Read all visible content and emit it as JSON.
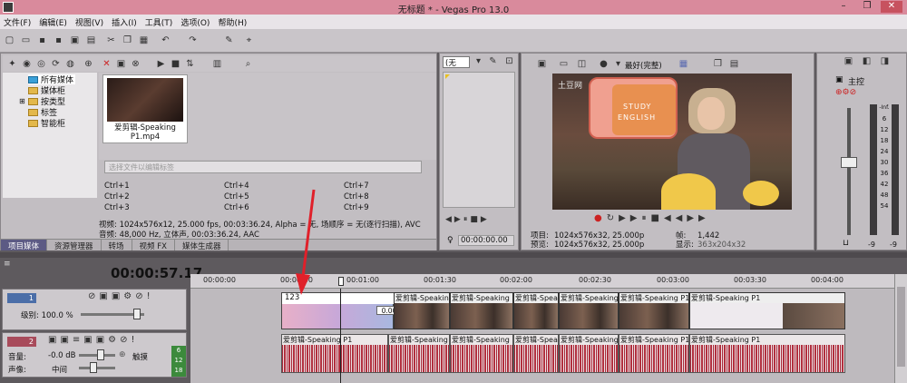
{
  "window": {
    "title": "无标题 * - Vegas Pro 13.0",
    "minimize": "–",
    "maximize": "❐",
    "close": "✕"
  },
  "menu": [
    "文件(F)",
    "编辑(E)",
    "视图(V)",
    "插入(I)",
    "工具(T)",
    "选项(O)",
    "帮助(H)"
  ],
  "media": {
    "tree": [
      "所有媒体",
      "媒体柜",
      "按类型",
      "标签",
      "智能柜"
    ],
    "thumb_label": "爱剪辑-Speaking P1.mp4",
    "tag_placeholder": "选择文件以编辑标签",
    "shortcuts": [
      "Ctrl+1",
      "Ctrl+2",
      "Ctrl+3",
      "Ctrl+4",
      "Ctrl+5",
      "Ctrl+6",
      "Ctrl+7",
      "Ctrl+8",
      "Ctrl+9"
    ],
    "info1": "视频: 1024x576x12, 25.000 fps, 00:03:36.24, Alpha = 无, 场顺序 = 无(逐行扫描), AVC",
    "info2": "音频: 48,000 Hz, 立体声, 00:03:36.24, AAC",
    "tabs": [
      "项目媒体",
      "资源管理器",
      "转场",
      "视频 FX",
      "媒体生成器"
    ]
  },
  "trimmer": {
    "select": "(无",
    "time": "00:00:00.00"
  },
  "preview": {
    "quality": "最好(完整)",
    "project_label": "项目:",
    "project": "1024x576x32, 25.000p",
    "preview_label": "预览:",
    "preview": "1024x576x32, 25.000p",
    "frame_label": "帧:",
    "frame": "1,442",
    "display_label": "显示:",
    "display": "363x204x32",
    "logo": "土豆网",
    "study_line1": "STUDY",
    "study_line2": "ENGLISH"
  },
  "mixer": {
    "label": "主控",
    "scale": [
      "-Inf.",
      "6",
      "12",
      "18",
      "24",
      "30",
      "36",
      "42",
      "48",
      "54"
    ],
    "bottom": [
      "-9",
      "-9"
    ]
  },
  "timeline": {
    "time": "00:00:57.17",
    "ruler": [
      "00:00:00",
      "00:00:30",
      "00:01:00",
      "00:01:30",
      "00:02:00",
      "00:02:30",
      "00:03:00",
      "00:03:30",
      "00:04:00"
    ],
    "video_track": {
      "num": "1",
      "level_label": "级别: 100.0 %"
    },
    "audio_track": {
      "num": "2",
      "volume_label": "音量:",
      "volume": "-0.0 dB",
      "pan_label": "声像:",
      "pan": "中间",
      "mode": "触摸"
    },
    "text_clip": "123",
    "clip_label": "爱剪辑-Speaking P1",
    "audio_clip_label": "爱剪辑-Speaking P1",
    "clip_badge": "0.00",
    "vu": [
      "6",
      "12",
      "18"
    ]
  },
  "colors": {
    "title_bar": "#d98a9c",
    "active_tab": "#5c5a84",
    "arrow": "#e0202a"
  }
}
